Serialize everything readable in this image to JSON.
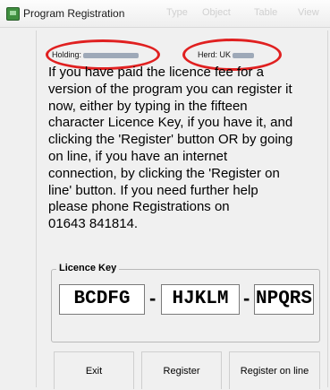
{
  "window": {
    "title": "Program Registration",
    "bg_menu": [
      "Type",
      "Object",
      "Table",
      "View"
    ]
  },
  "header": {
    "holding_label": "Holding:",
    "herd_label": "Herd: UK"
  },
  "instructions": "If you have paid the licence fee for a\nversion of the program you can register it\nnow, either by typing in the fifteen\ncharacter Licence Key, if you have it, and\nclicking the 'Register' button OR by going\non line, if you have an internet\nconnection, by clicking the 'Register on\nline' button. If you need further help\nplease phone Registrations on\n 01643 841814.",
  "licence": {
    "legend": "Licence Key",
    "parts": [
      "BCDFG",
      "HJKLM",
      "NPQRS"
    ],
    "separator": "-"
  },
  "buttons": {
    "exit": "Exit",
    "register": "Register",
    "register_online": "Register on line"
  },
  "colors": {
    "highlight_oval": "#e02020",
    "app_icon": "#3f8f3f"
  }
}
